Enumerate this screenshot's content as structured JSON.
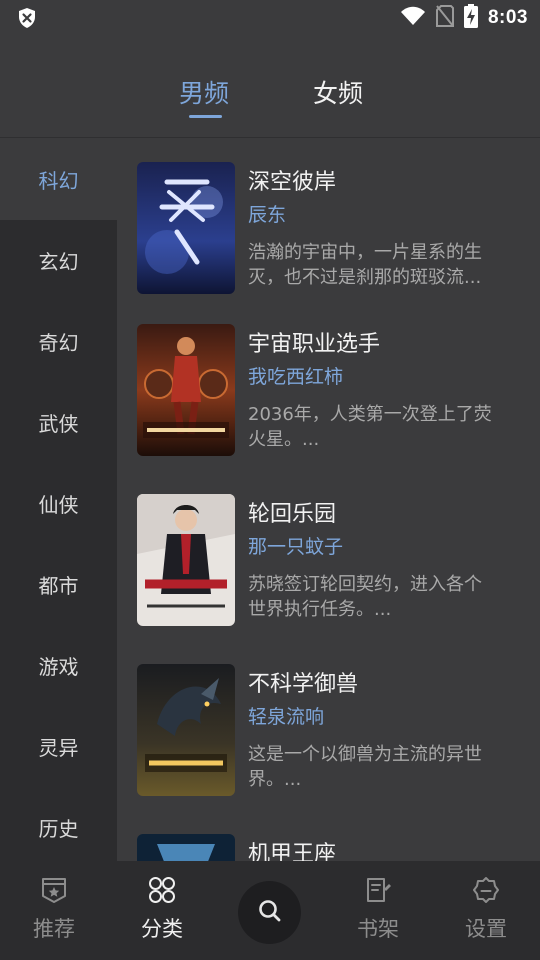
{
  "status_bar": {
    "time": "8:03",
    "icons": [
      "shield-icon",
      "wifi-icon",
      "no-sim-icon",
      "battery-charging-icon"
    ]
  },
  "gender_tabs": [
    {
      "label": "男频",
      "active": true
    },
    {
      "label": "女频",
      "active": false
    }
  ],
  "categories": [
    {
      "label": "科幻",
      "active": true
    },
    {
      "label": "玄幻",
      "active": false
    },
    {
      "label": "奇幻",
      "active": false
    },
    {
      "label": "武侠",
      "active": false
    },
    {
      "label": "仙侠",
      "active": false
    },
    {
      "label": "都市",
      "active": false
    },
    {
      "label": "游戏",
      "active": false
    },
    {
      "label": "灵异",
      "active": false
    },
    {
      "label": "历史",
      "active": false
    }
  ],
  "books": [
    {
      "title": "深空彼岸",
      "author": "辰东",
      "description": "浩瀚的宇宙中，一片星系的生\n灭，也不过是刹那的斑驳流..."
    },
    {
      "title": "宇宙职业选手",
      "author": "我吃西红柿",
      "description": "2036年，人类第一次登上了荧\n火星。..."
    },
    {
      "title": "轮回乐园",
      "author": "那一只蚊子",
      "description": "苏晓签订轮回契约，进入各个\n世界执行任务。..."
    },
    {
      "title": "不科学御兽",
      "author": "轻泉流响",
      "description": "这是一个以御兽为主流的异世\n界。..."
    },
    {
      "title": "机甲王座",
      "author": "",
      "description": ""
    }
  ],
  "bottom_nav": [
    {
      "label": "推荐",
      "icon": "star-badge-icon",
      "active": false
    },
    {
      "label": "分类",
      "icon": "grid-icon",
      "active": true
    },
    {
      "label": "",
      "icon": "search-icon",
      "active": false
    },
    {
      "label": "书架",
      "icon": "bookshelf-icon",
      "active": false
    },
    {
      "label": "设置",
      "icon": "gear-icon",
      "active": false
    }
  ],
  "colors": {
    "accent": "#7ea6da",
    "background": "#3b3b3d",
    "sidebar": "#2c2c2e"
  }
}
